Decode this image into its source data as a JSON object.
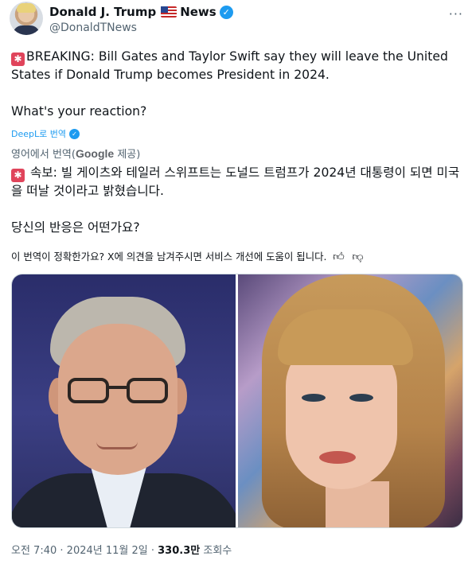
{
  "author": {
    "name": "Donald J. Trump",
    "name_suffix": "News",
    "handle": "@DonaldTNews",
    "avatar_icon": "avatar-photo",
    "verified_icon": "verified-badge-icon",
    "flag_icon": "us-flag-icon",
    "more_label": "···"
  },
  "post": {
    "siren_icon": "siren-emoji-icon",
    "breaking_text": "BREAKING: Bill Gates and Taylor Swift say they will leave the United States if Donald Trump becomes President in 2024.",
    "reaction_text": "What's your reaction?"
  },
  "translation": {
    "deepl_label": "DeepL로 번역",
    "google_prefix": "영어에서 번역(",
    "google_brand": "Google",
    "google_suffix": " 제공)",
    "ko_breaking": "속보: 빌 게이츠와 테일러 스위프트는 도널드 트럼프가 2024년 대통령이 되면 미국을 떠날 것이라고 밝혔습니다.",
    "ko_reaction": "당신의 반응은 어떤가요?",
    "feedback_text": "이 번역이 정확한가요? X에 의견을 남겨주시면 서비스 개선에 도움이 됩니다.",
    "like_icon": "thumbs-up-icon",
    "dislike_icon": "thumbs-down-icon"
  },
  "media": {
    "left_photo": "bill-gates-photo",
    "right_photo": "taylor-swift-photo"
  },
  "meta": {
    "time": "오전 7:40",
    "date": "2024년 11월 2일",
    "views_count": "330.3만",
    "views_label": "조회수",
    "separator": "·"
  },
  "colors": {
    "accent": "#1d9bf0",
    "text": "#0f1419",
    "muted": "#536471",
    "siren": "#e0445b"
  }
}
